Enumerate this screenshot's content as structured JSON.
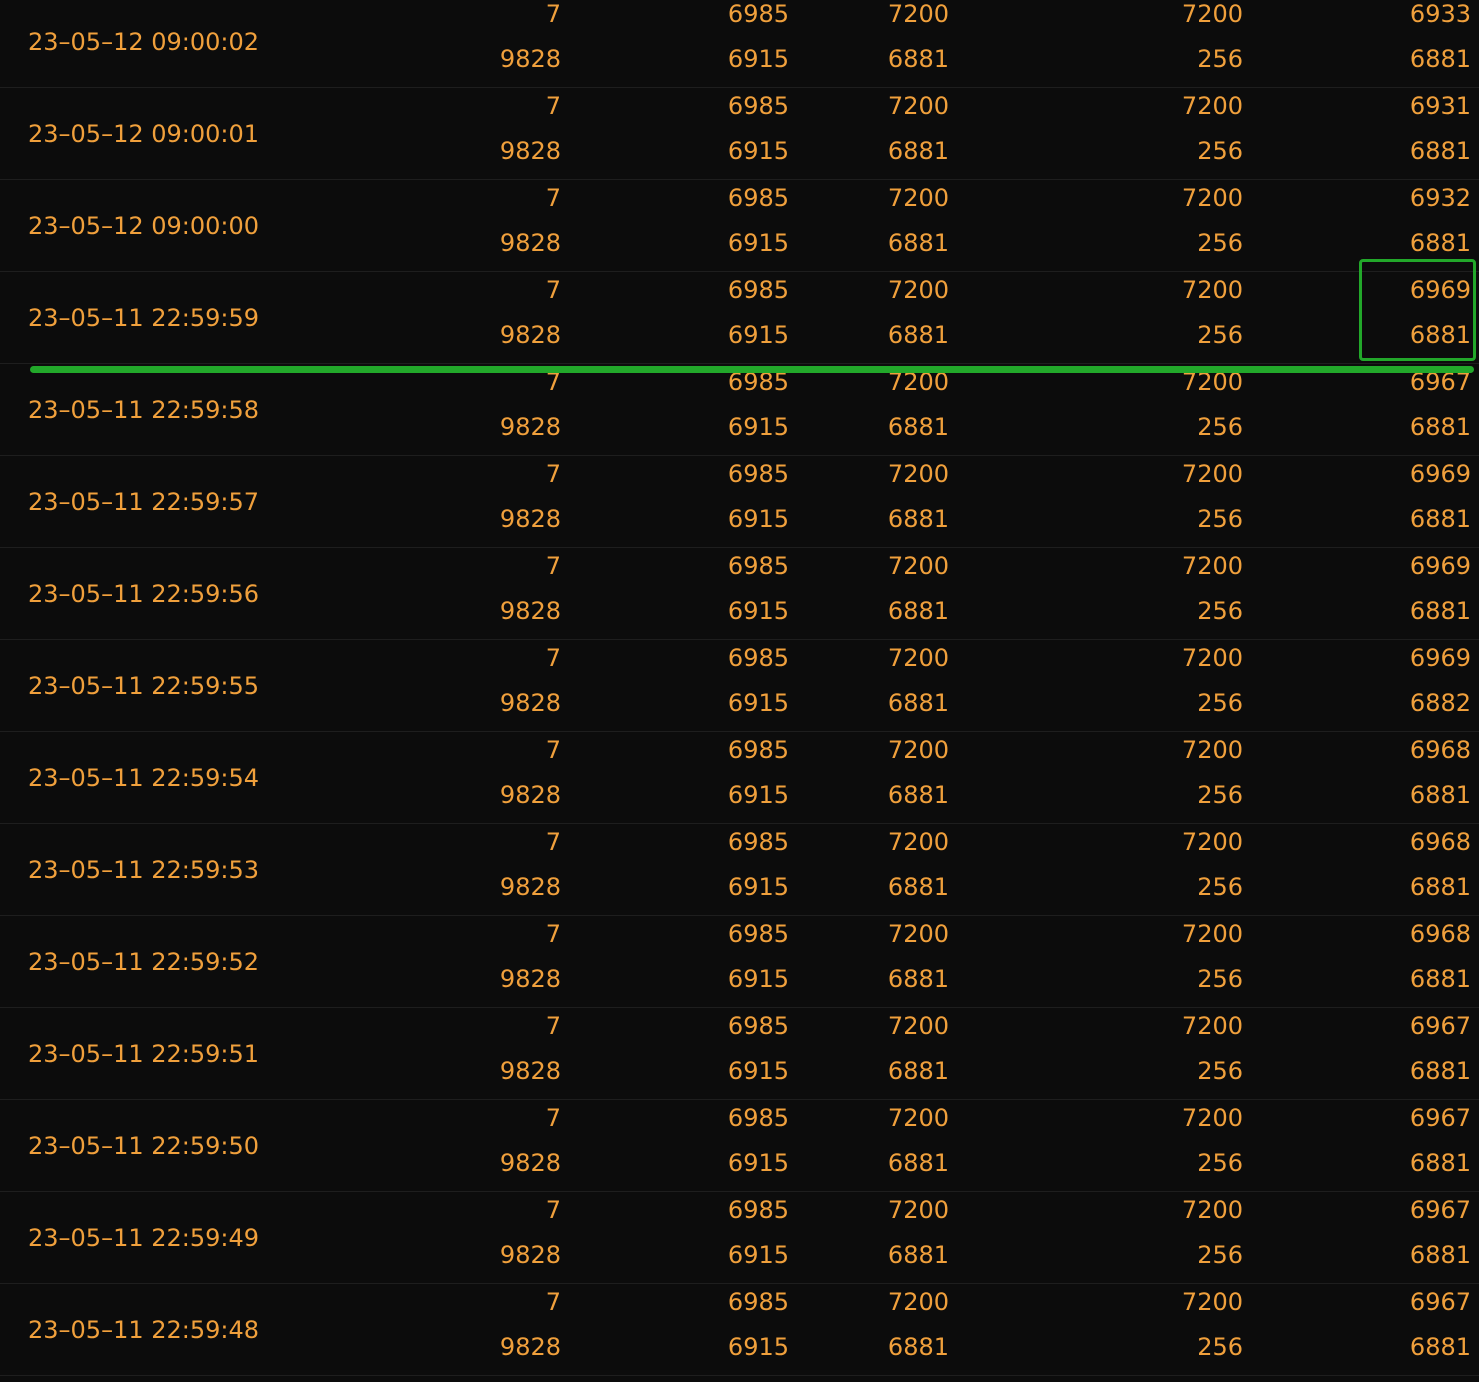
{
  "rows": [
    {
      "time": "23–05–12 09:00:02",
      "top": [
        "7",
        "6985",
        "7200",
        "7200",
        "6933"
      ],
      "bottom": [
        "9828",
        "6915",
        "6881",
        "256",
        "6881"
      ]
    },
    {
      "time": "23–05–12 09:00:01",
      "top": [
        "7",
        "6985",
        "7200",
        "7200",
        "6931"
      ],
      "bottom": [
        "9828",
        "6915",
        "6881",
        "256",
        "6881"
      ]
    },
    {
      "time": "23–05–12 09:00:00",
      "top": [
        "7",
        "6985",
        "7200",
        "7200",
        "6932"
      ],
      "bottom": [
        "9828",
        "6915",
        "6881",
        "256",
        "6881"
      ]
    },
    {
      "time": "23–05–11 22:59:59",
      "top": [
        "7",
        "6985",
        "7200",
        "7200",
        "6969"
      ],
      "bottom": [
        "9828",
        "6915",
        "6881",
        "256",
        "6881"
      ]
    },
    {
      "time": "23–05–11 22:59:58",
      "top": [
        "7",
        "6985",
        "7200",
        "7200",
        "6967"
      ],
      "bottom": [
        "9828",
        "6915",
        "6881",
        "256",
        "6881"
      ]
    },
    {
      "time": "23–05–11 22:59:57",
      "top": [
        "7",
        "6985",
        "7200",
        "7200",
        "6969"
      ],
      "bottom": [
        "9828",
        "6915",
        "6881",
        "256",
        "6881"
      ]
    },
    {
      "time": "23–05–11 22:59:56",
      "top": [
        "7",
        "6985",
        "7200",
        "7200",
        "6969"
      ],
      "bottom": [
        "9828",
        "6915",
        "6881",
        "256",
        "6881"
      ]
    },
    {
      "time": "23–05–11 22:59:55",
      "top": [
        "7",
        "6985",
        "7200",
        "7200",
        "6969"
      ],
      "bottom": [
        "9828",
        "6915",
        "6881",
        "256",
        "6882"
      ]
    },
    {
      "time": "23–05–11 22:59:54",
      "top": [
        "7",
        "6985",
        "7200",
        "7200",
        "6968"
      ],
      "bottom": [
        "9828",
        "6915",
        "6881",
        "256",
        "6881"
      ]
    },
    {
      "time": "23–05–11 22:59:53",
      "top": [
        "7",
        "6985",
        "7200",
        "7200",
        "6968"
      ],
      "bottom": [
        "9828",
        "6915",
        "6881",
        "256",
        "6881"
      ]
    },
    {
      "time": "23–05–11 22:59:52",
      "top": [
        "7",
        "6985",
        "7200",
        "7200",
        "6968"
      ],
      "bottom": [
        "9828",
        "6915",
        "6881",
        "256",
        "6881"
      ]
    },
    {
      "time": "23–05–11 22:59:51",
      "top": [
        "7",
        "6985",
        "7200",
        "7200",
        "6967"
      ],
      "bottom": [
        "9828",
        "6915",
        "6881",
        "256",
        "6881"
      ]
    },
    {
      "time": "23–05–11 22:59:50",
      "top": [
        "7",
        "6985",
        "7200",
        "7200",
        "6967"
      ],
      "bottom": [
        "9828",
        "6915",
        "6881",
        "256",
        "6881"
      ]
    },
    {
      "time": "23–05–11 22:59:49",
      "top": [
        "7",
        "6985",
        "7200",
        "7200",
        "6967"
      ],
      "bottom": [
        "9828",
        "6915",
        "6881",
        "256",
        "6881"
      ]
    },
    {
      "time": "23–05–11 22:59:48",
      "top": [
        "7",
        "6985",
        "7200",
        "7200",
        "6967"
      ],
      "bottom": [
        "9828",
        "6915",
        "6881",
        "256",
        "6881"
      ]
    }
  ],
  "colors": {
    "text": "#f0a03c",
    "background": "#0c0c0c",
    "highlight": "#22a82a",
    "divider": "#1e1e1e"
  }
}
